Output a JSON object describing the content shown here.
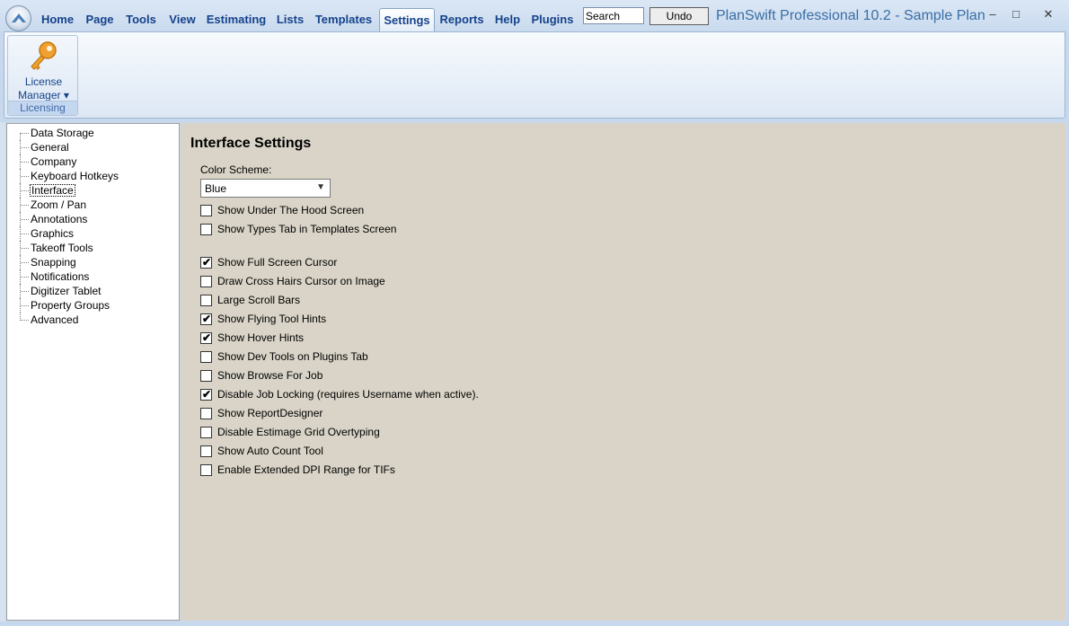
{
  "tabs": [
    "Home",
    "Page",
    "Tools",
    "View",
    "Estimating",
    "Lists",
    "Templates",
    "Settings",
    "Reports",
    "Help",
    "Plugins"
  ],
  "active_tab": "Settings",
  "search": {
    "value": "Search"
  },
  "undo_label": "Undo",
  "window_title": "PlanSwift Professional 10.2 - Sample Plan",
  "window_controls": {
    "minimize": "–",
    "maximize": "□",
    "close": "✕"
  },
  "ribbon": {
    "license_manager_line1": "License",
    "license_manager_line2": "Manager ▾",
    "group_label": "Licensing",
    "icon": "key-icon",
    "icon_color": "#f0a030"
  },
  "tree": {
    "items": [
      "Data Storage",
      "General",
      "Company",
      "Keyboard Hotkeys",
      "Interface",
      "Zoom / Pan",
      "Annotations",
      "Graphics",
      "Takeoff Tools",
      "Snapping",
      "Notifications",
      "Digitizer Tablet",
      "Property Groups",
      "Advanced"
    ],
    "selected": "Interface"
  },
  "interface": {
    "heading": "Interface Settings",
    "color_scheme_label": "Color Scheme:",
    "color_scheme_value": "Blue",
    "options": [
      {
        "label": "Show Under The Hood Screen",
        "checked": false
      },
      {
        "label": "Show Types Tab in Templates Screen",
        "checked": false
      },
      {
        "label": "Show Full Screen Cursor",
        "checked": true
      },
      {
        "label": "Draw Cross Hairs Cursor on Image",
        "checked": false
      },
      {
        "label": "Large Scroll Bars",
        "checked": false
      },
      {
        "label": "Show Flying Tool Hints",
        "checked": true
      },
      {
        "label": "Show Hover Hints",
        "checked": true
      },
      {
        "label": "Show Dev Tools on Plugins Tab",
        "checked": false
      },
      {
        "label": "Show Browse For Job",
        "checked": false
      },
      {
        "label": "Disable Job Locking (requires Username when active).",
        "checked": true
      },
      {
        "label": "Show ReportDesigner",
        "checked": false
      },
      {
        "label": "Disable Estimage Grid Overtyping",
        "checked": false
      },
      {
        "label": "Show Auto Count Tool",
        "checked": false
      },
      {
        "label": "Enable Extended DPI Range for TIFs",
        "checked": false
      }
    ]
  },
  "colors": {
    "tab_text": "#15428b",
    "content_bg": "#d9d4c7",
    "title_text": "#3a6ea5"
  }
}
